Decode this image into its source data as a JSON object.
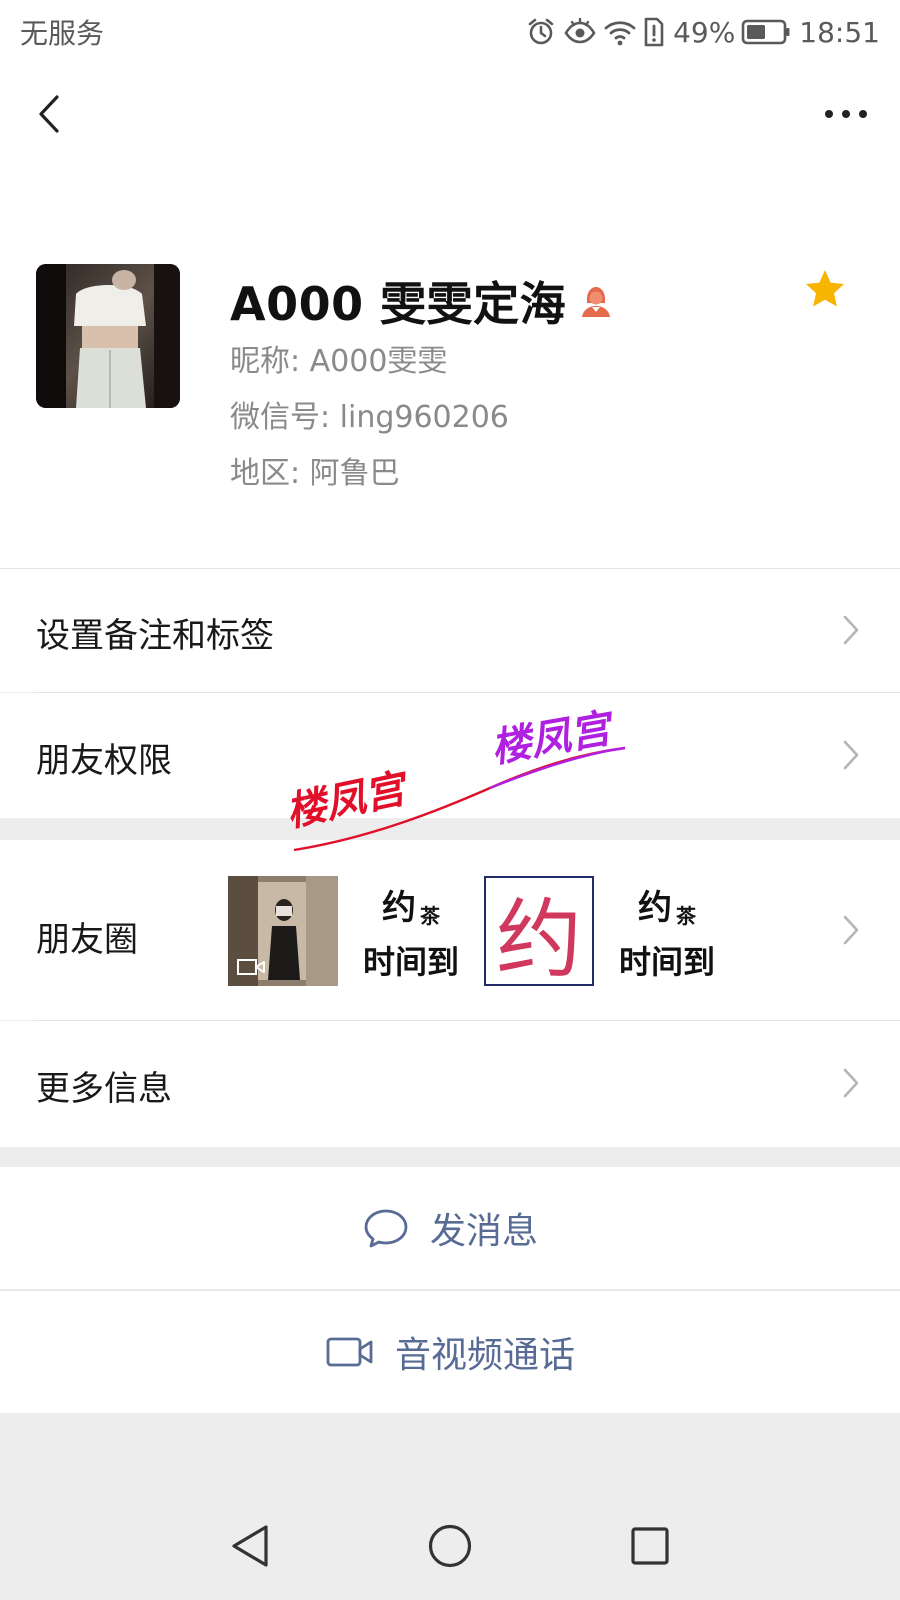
{
  "status_bar": {
    "carrier": "无服务",
    "battery": "49%",
    "time": "18:51"
  },
  "nav": {
    "back_icon": "chevron-left-icon",
    "more_icon": "more-dots-icon"
  },
  "profile": {
    "display_name": "A000 雯雯定海",
    "nickname_line": "昵称:  A000雯雯",
    "wechat_id_line": "微信号:  ling960206",
    "region_line": "地区:  阿鲁巴",
    "gender_icon": "female-user-icon",
    "star_icon": "star-icon",
    "star_color": "#f7b500"
  },
  "menu": {
    "remarks_label": "设置备注和标签",
    "permissions_label": "朋友权限",
    "moments_label": "朋友圈",
    "more_info_label": "更多信息"
  },
  "moments": {
    "thumb2_line1": "约",
    "thumb2_small": "茶",
    "thumb2_line2": "时间到",
    "thumb3_char": "约",
    "thumb4_line1": "约",
    "thumb4_small": "茶",
    "thumb4_line2": "时间到"
  },
  "watermarks": {
    "mark1": "楼凤宫",
    "mark2": "楼凤宫"
  },
  "actions": {
    "message_label": "发消息",
    "call_label": "音视频通话",
    "link_color": "#576b95"
  },
  "system_nav": {
    "back_icon": "triangle-back-icon",
    "home_icon": "circle-home-icon",
    "recents_icon": "square-recents-icon"
  }
}
